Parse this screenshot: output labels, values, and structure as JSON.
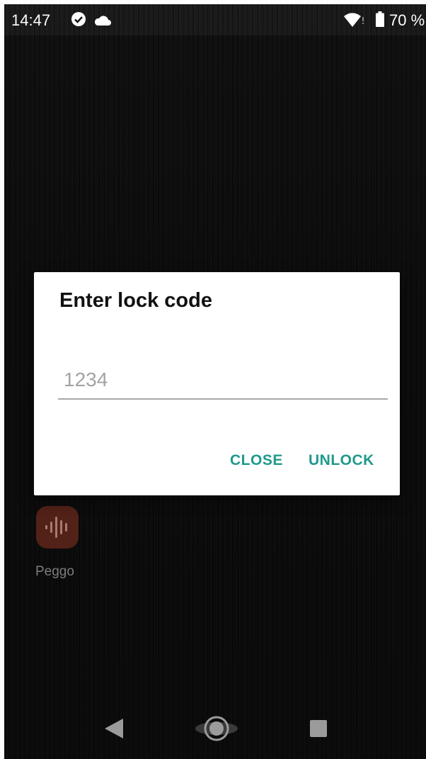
{
  "status_bar": {
    "time": "14:47",
    "battery_level": "70 %",
    "icons": [
      "check-circle-icon",
      "cloud-icon",
      "wifi-icon",
      "battery-icon"
    ]
  },
  "dialog": {
    "title": "Enter lock code",
    "input_placeholder": "1234",
    "input_value": "",
    "close_label": "CLOSE",
    "unlock_label": "UNLOCK"
  },
  "home": {
    "apps": [
      {
        "label": "Peggo",
        "icon": "audio-wave-icon",
        "color": "#5a2419"
      }
    ]
  },
  "nav_bar": {
    "icons": [
      "back-icon",
      "home-icon",
      "recents-icon"
    ]
  },
  "colors": {
    "accent": "#1f9a8c",
    "dialog_bg": "#ffffff",
    "wallpaper": "#141414"
  }
}
